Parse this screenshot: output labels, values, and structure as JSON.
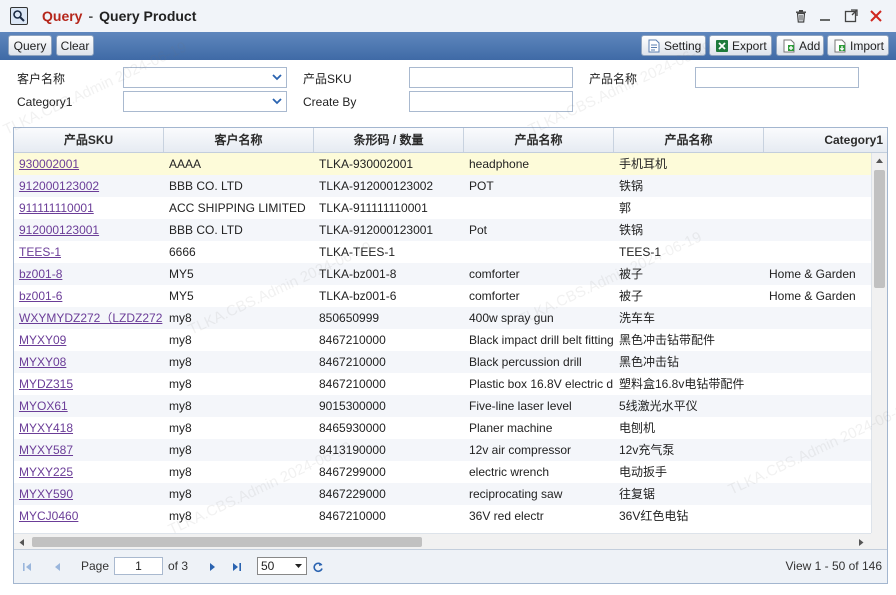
{
  "window": {
    "app_name": "Query",
    "separator": "-",
    "page_title": "Query Product",
    "icons": [
      "search-icon",
      "trash-icon",
      "minimize-icon",
      "maximize-icon",
      "close-icon"
    ]
  },
  "toolbar": {
    "query_label": "Query",
    "clear_label": "Clear",
    "setting_label": "Setting",
    "export_label": "Export",
    "add_label": "Add",
    "import_label": "Import"
  },
  "filters": {
    "customer_name_label": "客户名称",
    "product_sku_label": "产品SKU",
    "product_name_label": "产品名称",
    "category1_label": "Category1",
    "create_by_label": "Create By",
    "customer_name_value": "",
    "product_sku_value": "",
    "product_name_value": "",
    "category1_value": "",
    "create_by_value": ""
  },
  "grid": {
    "columns": [
      "产品SKU",
      "客户名称",
      "条形码 / 数量",
      "产品名称",
      "产品名称",
      "Category1"
    ],
    "rows": [
      [
        "930002001",
        "AAAA",
        "TLKA-930002001",
        "headphone",
        "手机耳机",
        ""
      ],
      [
        "912000123002",
        "BBB CO. LTD",
        "TLKA-912000123002",
        "POT",
        "铁锅",
        ""
      ],
      [
        "911111110001",
        "ACC SHIPPING LIMITED",
        "TLKA-911111110001",
        "",
        "郭",
        ""
      ],
      [
        "912000123001",
        "BBB CO. LTD",
        "TLKA-912000123001",
        "Pot",
        "铁锅",
        ""
      ],
      [
        "TEES-1",
        "6666",
        "TLKA-TEES-1",
        "",
        "TEES-1",
        ""
      ],
      [
        "bz001-8",
        "MY5",
        "TLKA-bz001-8",
        "comforter",
        "被子",
        "Home & Garden"
      ],
      [
        "bz001-6",
        "MY5",
        "TLKA-bz001-6",
        "comforter",
        "被子",
        "Home & Garden"
      ],
      [
        "WXYMYDZ272（LZDZ272",
        "my8",
        "850650999",
        "400w spray gun",
        "洗车车",
        ""
      ],
      [
        "MYXY09",
        "my8",
        "8467210000",
        "Black impact drill belt fitting",
        "黑色冲击钻带配件",
        ""
      ],
      [
        "MYXY08",
        "my8",
        "8467210000",
        "Black percussion drill",
        "黑色冲击钻",
        ""
      ],
      [
        "MYDZ315",
        "my8",
        "8467210000",
        "Plastic box 16.8V electric d",
        "塑料盒16.8v电钻带配件",
        ""
      ],
      [
        "MYOX61",
        "my8",
        "9015300000",
        "Five-line laser level",
        "5线激光水平仪",
        ""
      ],
      [
        "MYXY418",
        "my8",
        "8465930000",
        "Planer machine",
        "电刨机",
        ""
      ],
      [
        "MYXY587",
        "my8",
        "8413190000",
        "12v air compressor",
        "12v充气泵",
        ""
      ],
      [
        "MYXY225",
        "my8",
        "8467299000",
        "electric wrench",
        "电动扳手",
        ""
      ],
      [
        "MYXY590",
        "my8",
        "8467229000",
        "reciprocating saw",
        "往复锯",
        ""
      ],
      [
        "MYCJ0460",
        "my8",
        "8467210000",
        "36V red electr",
        "36V红色电钻",
        ""
      ]
    ]
  },
  "pager": {
    "page_label": "Page",
    "page_value": "1",
    "of_label": "of 3",
    "page_size": "50",
    "view_text": "View 1 - 50 of 146"
  },
  "watermark": "TLKA.CBS.Admin 2024-06-19",
  "colors": {
    "toolbar": "#4a75b0",
    "link": "#6b3d98",
    "title_app": "#b5261b",
    "selected_row": "#fdfbd9"
  }
}
